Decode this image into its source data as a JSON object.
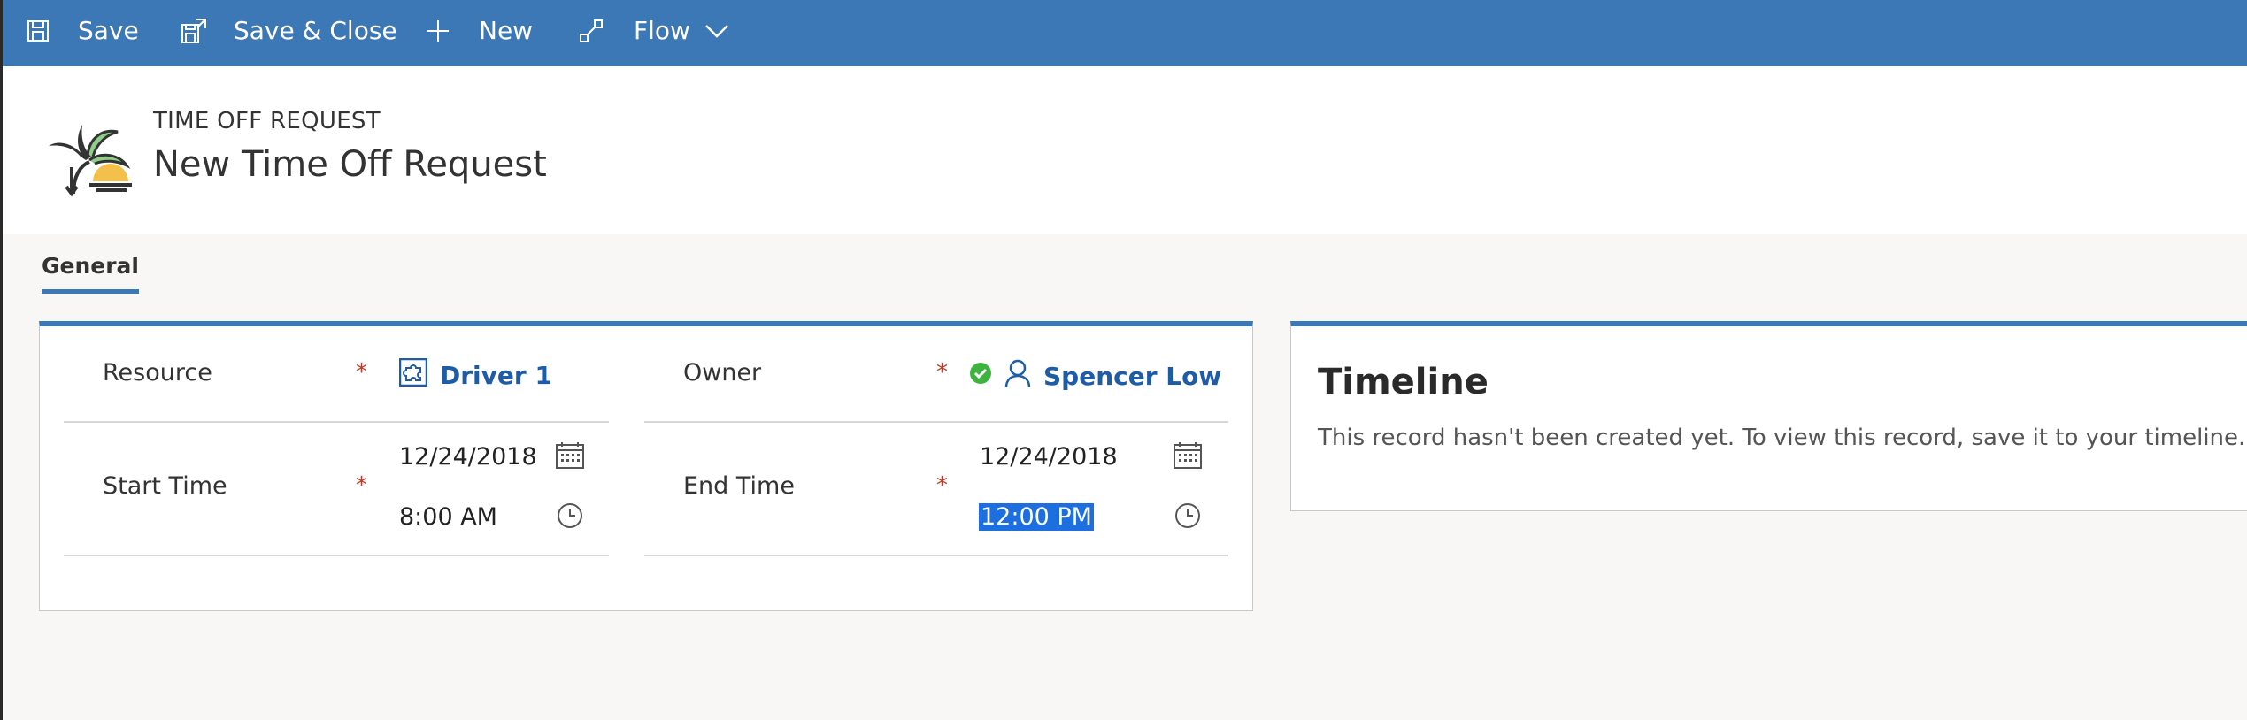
{
  "toolbar": {
    "save_label": "Save",
    "save_close_label": "Save & Close",
    "new_label": "New",
    "flow_label": "Flow"
  },
  "header": {
    "entity_type": "TIME OFF REQUEST",
    "record_title": "New Time Off Request",
    "icon": "palm-tree-sunset-icon"
  },
  "tabs": [
    {
      "label": "General",
      "selected": true
    }
  ],
  "form": {
    "resource": {
      "label": "Resource",
      "required_marker": "*",
      "value": "Driver 1",
      "icon": "resource-puzzle-icon"
    },
    "owner": {
      "label": "Owner",
      "required_marker": "*",
      "value": "Spencer Low",
      "status_icon": "available-check-icon",
      "icon": "person-icon"
    },
    "start_time": {
      "label": "Start Time",
      "required_marker": "*",
      "date": "12/24/2018",
      "time": "8:00 AM"
    },
    "end_time": {
      "label": "End Time",
      "required_marker": "*",
      "date": "12/24/2018",
      "time": "12:00 PM"
    }
  },
  "timeline": {
    "title": "Timeline",
    "message": "This record hasn't been created yet.  To view this record, save it to your timeline."
  },
  "colors": {
    "accent": "#3d78b6",
    "link": "#1f5ca8",
    "required": "#c0392b",
    "available": "#3fb33f",
    "selection": "#1d6fe0"
  }
}
